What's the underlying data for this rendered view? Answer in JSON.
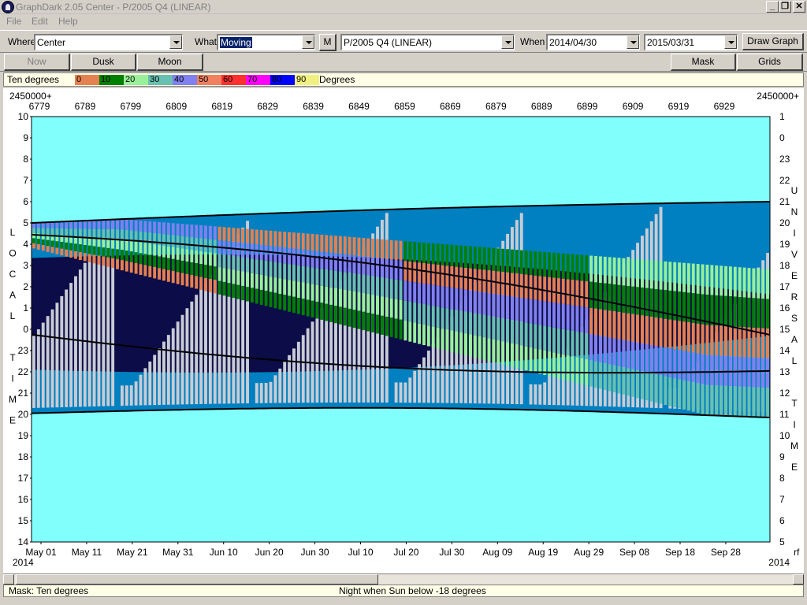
{
  "window": {
    "title": "GraphDark 2.05  Center  -  P/2005 Q4 (LINEAR)",
    "minimize": "_",
    "restore": "❐",
    "close": "✕"
  },
  "menu": {
    "file": "File",
    "edit": "Edit",
    "help": "Help"
  },
  "toolbar": {
    "where_label": "Where",
    "where_value": "Center",
    "what_label": "What",
    "what_value": "Moving",
    "m_button": "M",
    "object_value": "P/2005 Q4 (LINEAR)",
    "when_label": "When",
    "start_date": "2014/04/30",
    "end_date": "2015/03/31",
    "draw_graph": "Draw Graph"
  },
  "toolbar2": {
    "now": "Now",
    "dusk": "Dusk",
    "moon": "Moon",
    "mask": "Mask",
    "grids": "Grids"
  },
  "legend": {
    "label": "Ten degrees",
    "unit": "Degrees",
    "bins": [
      {
        "label": "0",
        "color": "#e58050"
      },
      {
        "label": "10",
        "color": "#008000"
      },
      {
        "label": "20",
        "color": "#98f098"
      },
      {
        "label": "30",
        "color": "#68c0b0"
      },
      {
        "label": "40",
        "color": "#8080f0"
      },
      {
        "label": "50",
        "color": "#f08060"
      },
      {
        "label": "60",
        "color": "#ff3030"
      },
      {
        "label": "70",
        "color": "#ff00ff"
      },
      {
        "label": "80",
        "color": "#0000ff"
      },
      {
        "label": "90",
        "color": "#f0f080"
      }
    ]
  },
  "chart_data": {
    "type": "heatmap",
    "top_axis": {
      "prefix_left": "2450000+",
      "prefix_right": "2450000+",
      "ticks": [
        "6779",
        "6789",
        "6799",
        "6809",
        "6819",
        "6829",
        "6839",
        "6849",
        "6859",
        "6869",
        "6879",
        "6889",
        "6899",
        "6909",
        "6919",
        "6929"
      ]
    },
    "bottom_axis": {
      "ticks": [
        "May 01",
        "May 11",
        "May 21",
        "May 31",
        "Jun 10",
        "Jun 20",
        "Jun 30",
        "Jul 10",
        "Jul 20",
        "Jul 30",
        "Aug 09",
        "Aug 19",
        "Aug 29",
        "Sep 08",
        "Sep 18",
        "Sep 28"
      ],
      "year_left": "2014",
      "year_right": "2014",
      "overflow": "rf"
    },
    "left_axis": {
      "title": [
        "L",
        "O",
        "C",
        "A",
        "L",
        "",
        "T",
        "I",
        "M",
        "E"
      ],
      "ticks": [
        "10",
        "9",
        "8",
        "7",
        "6",
        "5",
        "4",
        "3",
        "2",
        "1",
        "0",
        "23",
        "22",
        "21",
        "20",
        "19",
        "18",
        "17",
        "16",
        "15",
        "14"
      ]
    },
    "right_axis": {
      "title": [
        "U",
        "N",
        "I",
        "V",
        "E",
        "R",
        "S",
        "A",
        "L",
        "",
        "T",
        "I",
        "M",
        "E"
      ],
      "ticks": [
        "1",
        "0",
        "23",
        "22",
        "21",
        "20",
        "19",
        "18",
        "17",
        "16",
        "15",
        "14",
        "13",
        "12",
        "11",
        "10",
        "9",
        "8",
        "7",
        "6",
        "5"
      ]
    },
    "colors": {
      "day": "#80fffd",
      "night": "#0c0c48",
      "twilight": "#0080c0",
      "moonlit": "#c8ccd4"
    }
  },
  "status": {
    "mask": "Mask:  Ten degrees",
    "night": "Night when Sun below -18 degrees"
  }
}
